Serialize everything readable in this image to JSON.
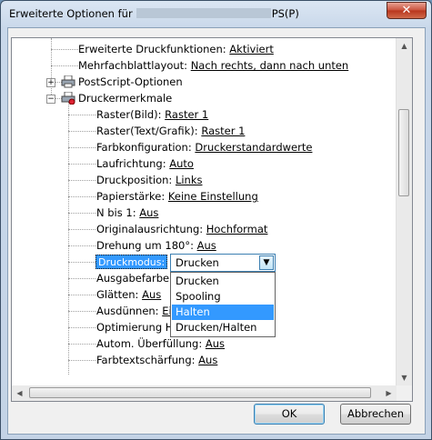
{
  "window": {
    "title_prefix": "Erweiterte Optionen für",
    "title_suffix": "PS(P)",
    "close_glyph": "✕"
  },
  "tree": {
    "rows": [
      {
        "label": "Erweiterte Druckfunktionen:",
        "value": "Aktiviert"
      },
      {
        "label": "Mehrfachblattlayout:",
        "value": "Nach rechts, dann nach unten"
      },
      {
        "label": "PostScript-Optionen",
        "value": ""
      },
      {
        "label": "Druckermerkmale",
        "value": ""
      },
      {
        "label": "Raster(Bild):",
        "value": "Raster 1"
      },
      {
        "label": "Raster(Text/Grafik):",
        "value": "Raster 1"
      },
      {
        "label": "Farbkonfiguration:",
        "value": "Druckerstandardwerte"
      },
      {
        "label": "Laufrichtung:",
        "value": "Auto"
      },
      {
        "label": "Druckposition:",
        "value": "Links"
      },
      {
        "label": "Papierstärke:",
        "value": "Keine Einstellung"
      },
      {
        "label": "N bis 1:",
        "value": "Aus"
      },
      {
        "label": "Originalausrichtung:",
        "value": "Hochformat"
      },
      {
        "label": "Drehung um 180°:",
        "value": "Aus"
      },
      {
        "label": "Druckmodus:",
        "value": ""
      },
      {
        "label": "Ausgabefarbe:",
        "value": ""
      },
      {
        "label": "Glätten:",
        "value": "Aus"
      },
      {
        "label": "Ausdünnen:",
        "value": "Ein"
      },
      {
        "label": "Optimierung H",
        "value": ""
      },
      {
        "label": "Autom. Überfüllung:",
        "value": "Aus"
      },
      {
        "label": "Farbtextschärfung:",
        "value": "Aus"
      }
    ],
    "expand_plus": "+",
    "expand_minus": "−"
  },
  "combo": {
    "value": "Drucken",
    "options": [
      "Drucken",
      "Spooling",
      "Halten",
      "Drucken/Halten"
    ],
    "highlighted": "Halten"
  },
  "buttons": {
    "ok": "OK",
    "cancel": "Abbrechen"
  }
}
